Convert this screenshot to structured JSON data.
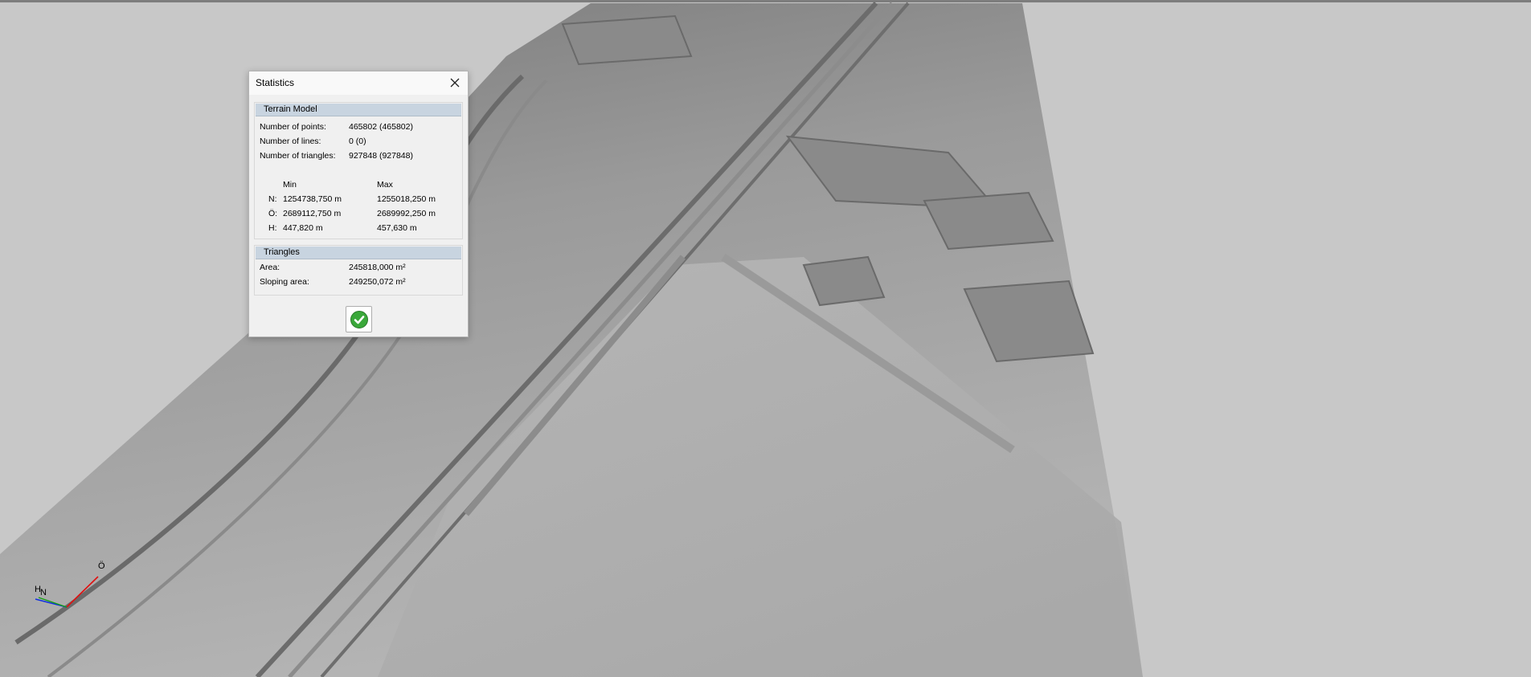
{
  "dialog": {
    "title": "Statistics",
    "terrain": {
      "header": "Terrain Model",
      "points_label": "Number of points:",
      "points_value": "465802 (465802)",
      "lines_label": "Number of lines:",
      "lines_value": "0 (0)",
      "triangles_label": "Number of triangles:",
      "triangles_value": "927848 (927848)",
      "min_header": "Min",
      "max_header": "Max",
      "n_label": "N:",
      "n_min": "1254738,750 m",
      "n_max": "1255018,250 m",
      "o_label": "Ö:",
      "o_min": "2689112,750 m",
      "o_max": "2689992,250 m",
      "h_label": "H:",
      "h_min": "447,820 m",
      "h_max": "457,630 m"
    },
    "triangles": {
      "header": "Triangles",
      "area_label": "Area:",
      "area_value": "245818,000 m²",
      "sloping_label": "Sloping area:",
      "sloping_value": "249250,072 m²"
    },
    "ok_icon": "check-icon"
  },
  "gizmo": {
    "h_label": "H",
    "n_label": "N",
    "o_label": "Ö",
    "colors": {
      "x": "#e01010",
      "y": "#10a010",
      "z": "#1030e0"
    }
  },
  "colors": {
    "background": "#c8c8c8",
    "dialog_bg": "#f0f0f0",
    "group_header": "#c8d4e0",
    "ok_green": "#3aa83a"
  }
}
